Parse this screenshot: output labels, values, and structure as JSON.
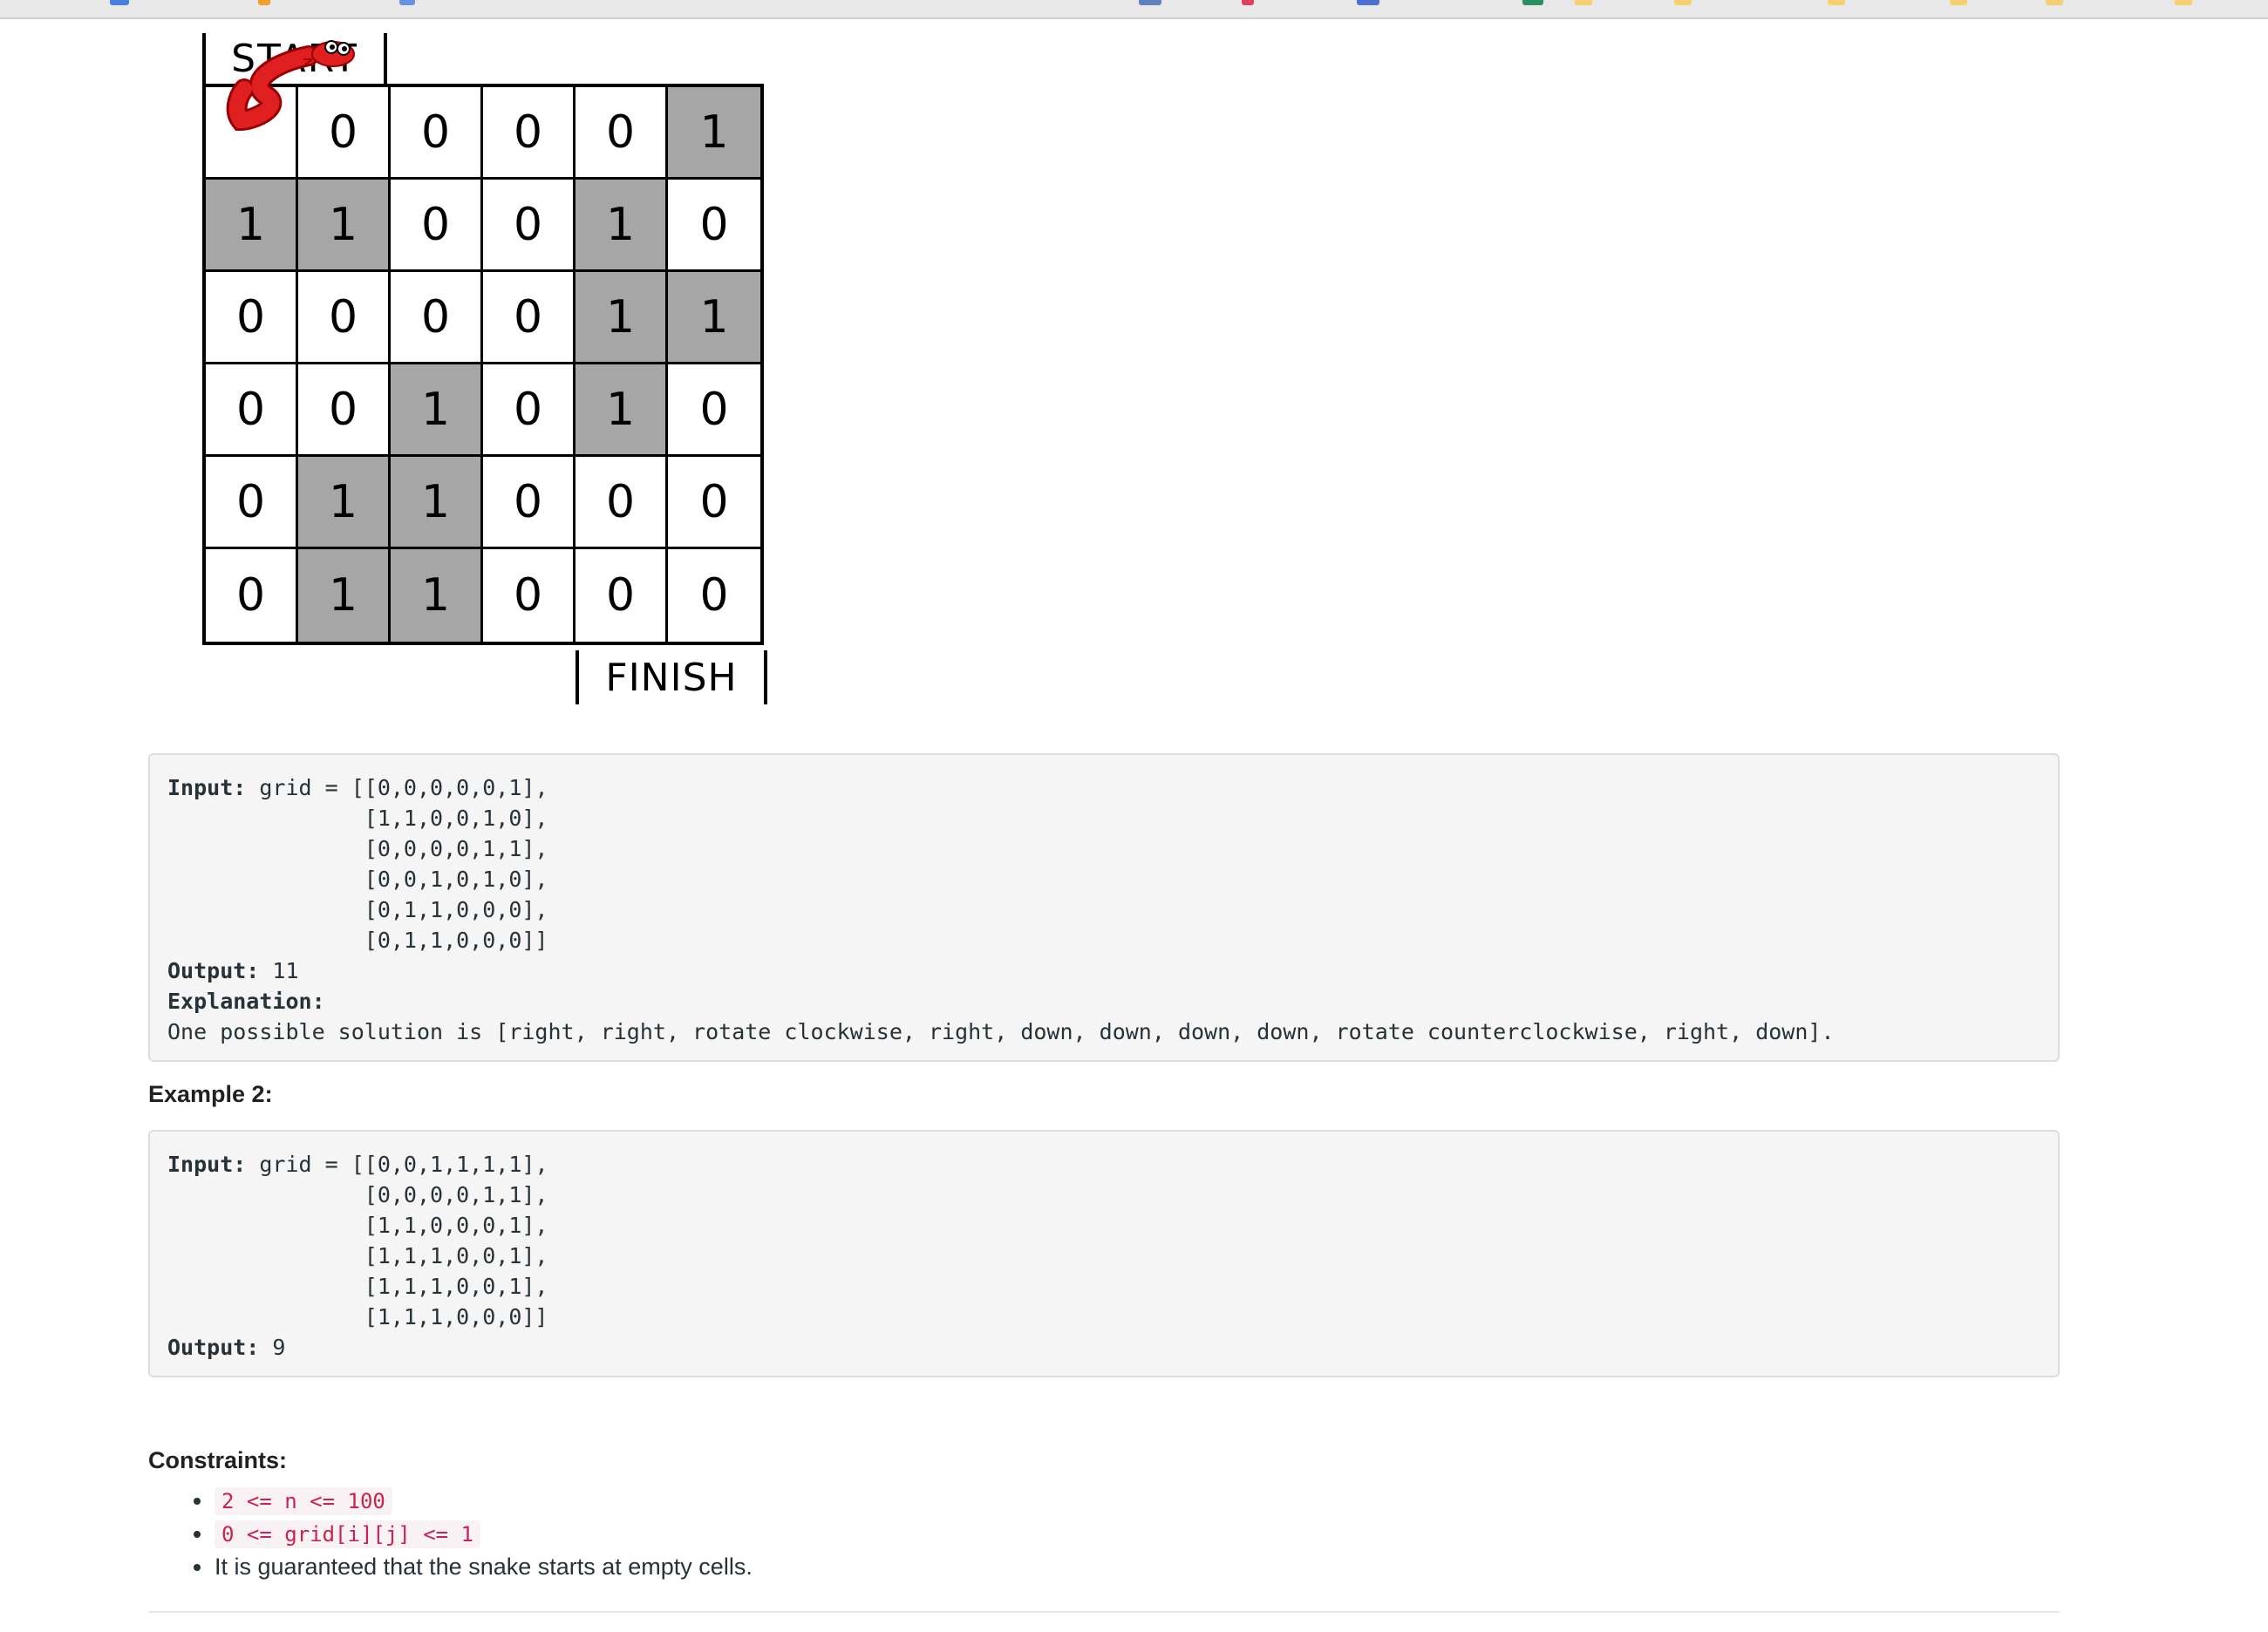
{
  "figure": {
    "start_label": "START",
    "finish_label": "FINISH",
    "grid": [
      [
        "",
        "0",
        "0",
        "0",
        "0",
        "1"
      ],
      [
        "1",
        "1",
        "0",
        "0",
        "1",
        "0"
      ],
      [
        "0",
        "0",
        "0",
        "0",
        "1",
        "1"
      ],
      [
        "0",
        "0",
        "1",
        "0",
        "1",
        "0"
      ],
      [
        "0",
        "1",
        "1",
        "0",
        "0",
        "0"
      ],
      [
        "0",
        "1",
        "1",
        "0",
        "0",
        "0"
      ]
    ],
    "snake_icon": "snake-icon"
  },
  "example1": {
    "input_label": "Input:",
    "input_text": " grid = [[0,0,0,0,0,1],\n               [1,1,0,0,1,0],\n               [0,0,0,0,1,1],\n               [0,0,1,0,1,0],\n               [0,1,1,0,0,0],\n               [0,1,1,0,0,0]]",
    "output_label": "Output:",
    "output_text": " 11",
    "explanation_label": "Explanation:",
    "explanation_text": "One possible solution is [right, right, rotate clockwise, right, down, down, down, down, rotate counterclockwise, right, down]."
  },
  "example2": {
    "heading": "Example 2:",
    "input_label": "Input:",
    "input_text": " grid = [[0,0,1,1,1,1],\n               [0,0,0,0,1,1],\n               [1,1,0,0,0,1],\n               [1,1,1,0,0,1],\n               [1,1,1,0,0,1],\n               [1,1,1,0,0,0]]",
    "output_label": "Output:",
    "output_text": " 9"
  },
  "constraints": {
    "heading": "Constraints:",
    "items": [
      {
        "code": "2 <= n <= 100"
      },
      {
        "code": "0 <= grid[i][j] <= 1"
      },
      {
        "text": "It is guaranteed that the snake starts at empty cells."
      }
    ]
  },
  "colors": {
    "blocked_cell": "#a6a6a6",
    "code_block_bg": "#f5f5f5",
    "inline_code": "#c7254e",
    "snake": "#e02020"
  }
}
